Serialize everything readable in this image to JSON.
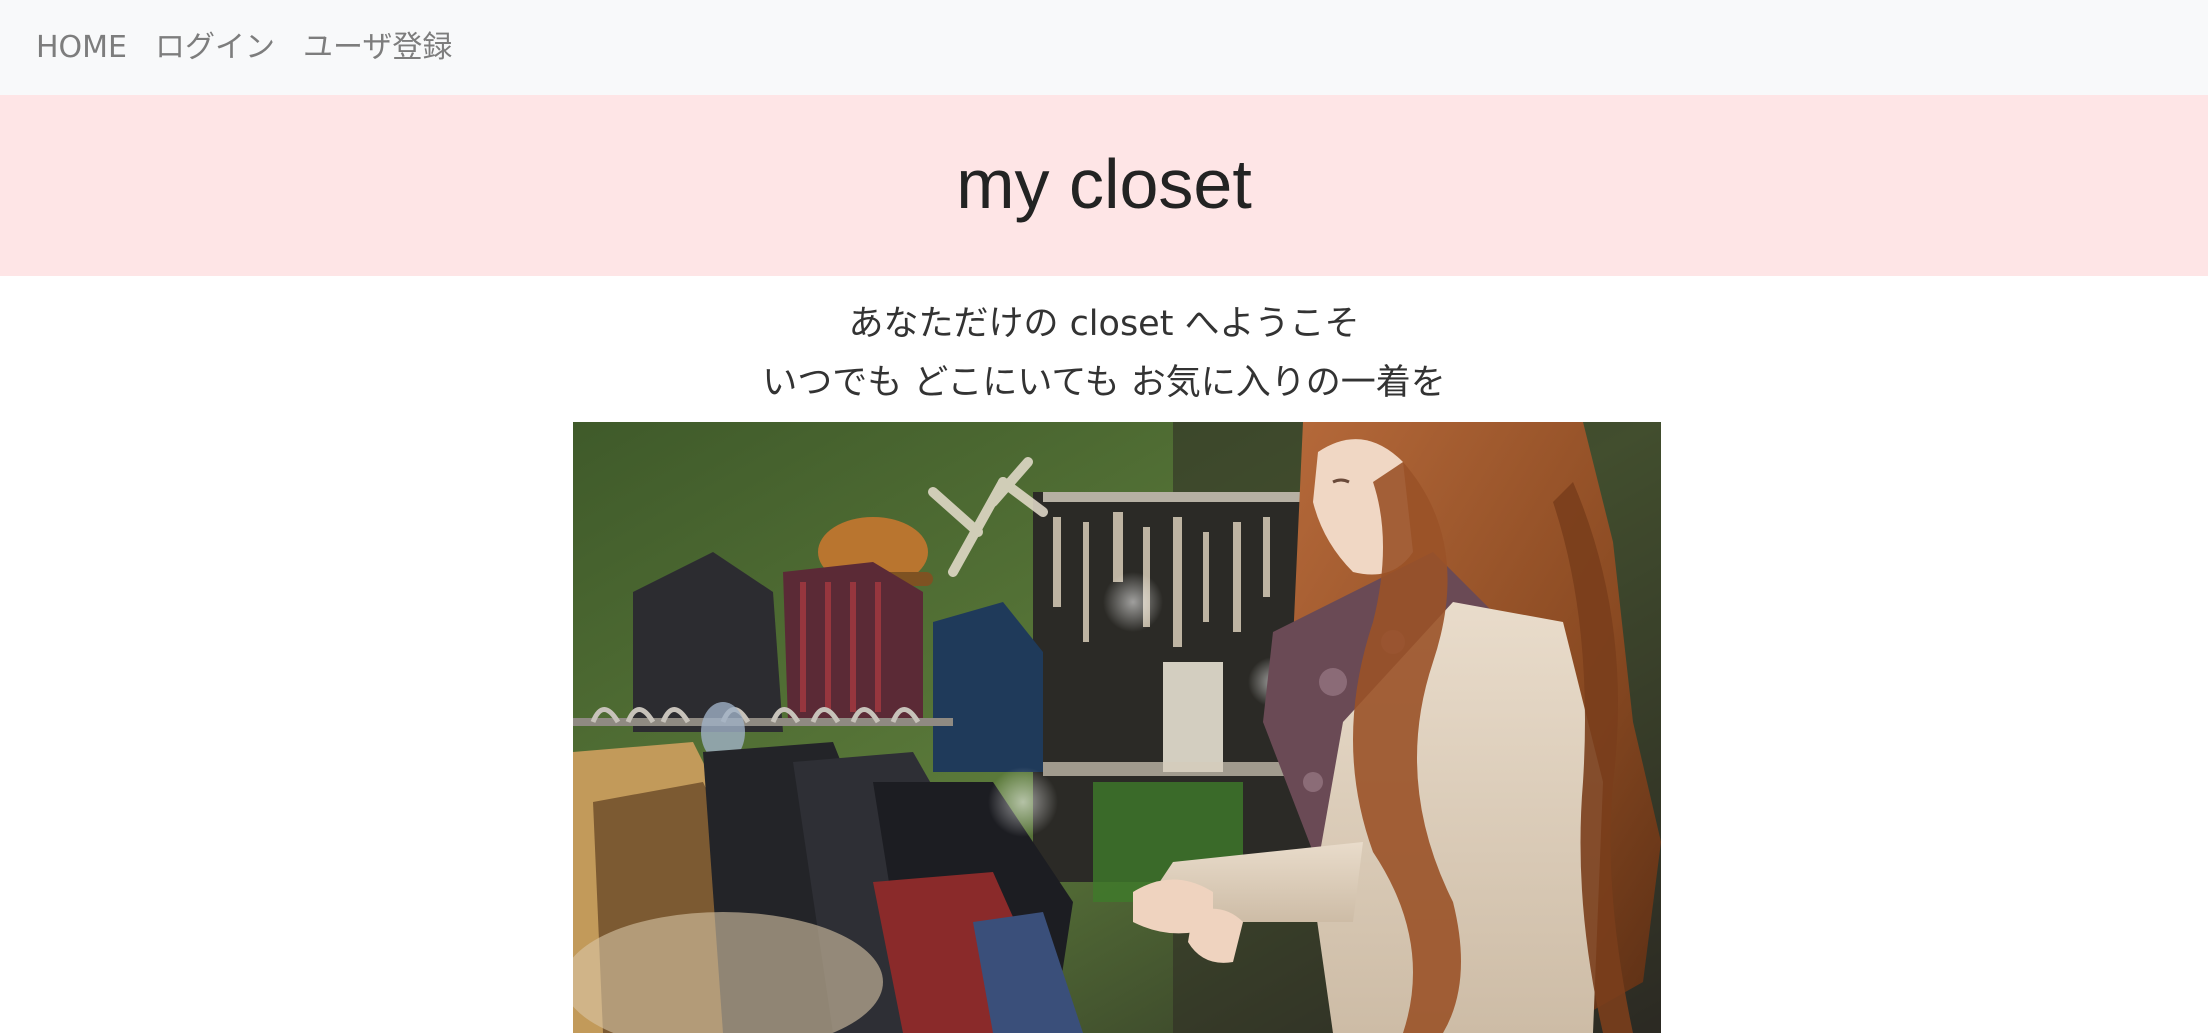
{
  "navbar": {
    "links": [
      {
        "label": "HOME"
      },
      {
        "label": "ログイン"
      },
      {
        "label": "ユーザ登録"
      }
    ]
  },
  "hero": {
    "title": "my closet"
  },
  "intro": {
    "line1": "あなただけの closet へようこそ",
    "line2": "いつでも どこにいても お気に入りの一着を"
  },
  "image": {
    "subject": "woman-browsing-clothing-rack-photo"
  },
  "colors": {
    "navbar_bg": "#f8f9fa",
    "hero_bg": "#fee5e6",
    "nav_text": "#7d7d7d",
    "title_text": "#232323"
  }
}
